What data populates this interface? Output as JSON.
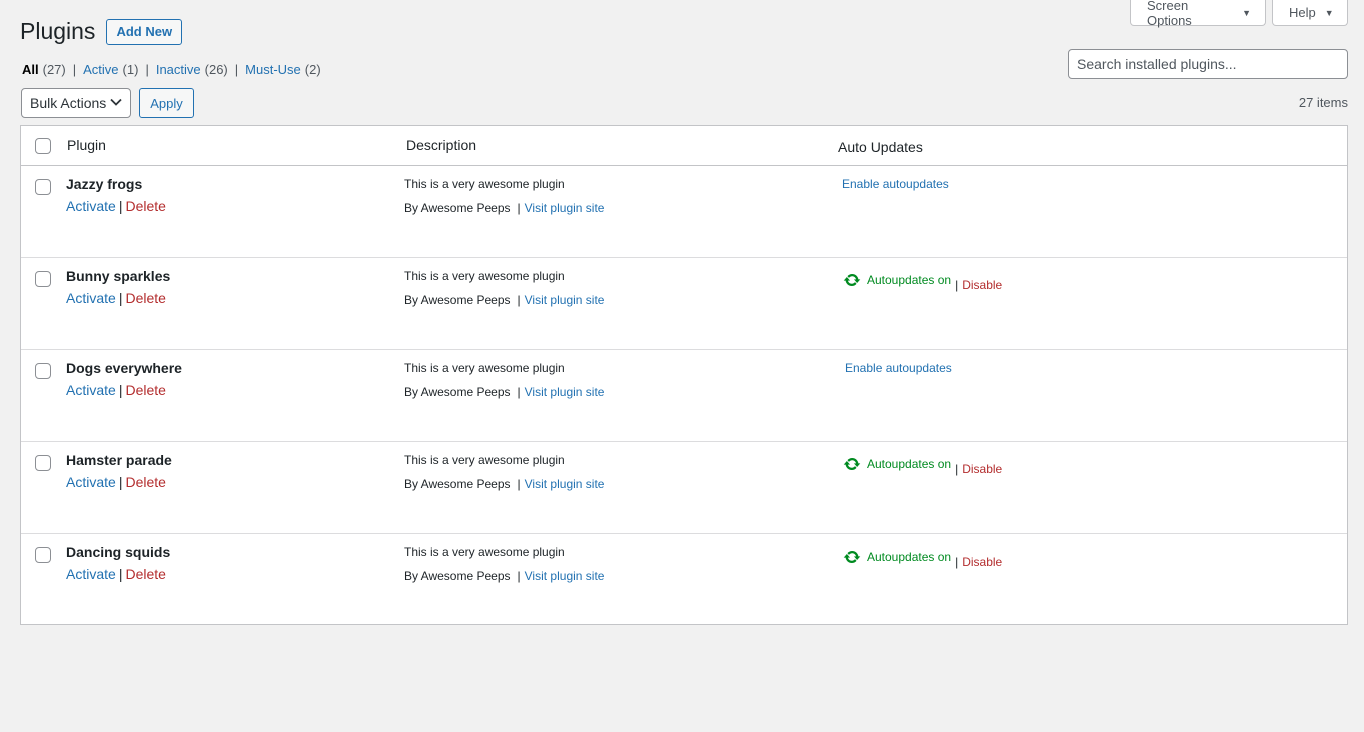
{
  "header": {
    "screen_options": "Screen Options",
    "help": "Help",
    "title": "Plugins",
    "add_new": "Add New"
  },
  "filters": {
    "all_label": "All",
    "all_count": "(27)",
    "active_label": "Active",
    "active_count": "(1)",
    "inactive_label": "Inactive",
    "inactive_count": "(26)",
    "mustuse_label": "Must-Use",
    "mustuse_count": "(2)",
    "separator": "|"
  },
  "search": {
    "placeholder": "Search installed plugins..."
  },
  "tablenav": {
    "bulk_actions": "Bulk Actions",
    "apply": "Apply",
    "items_count": "27 items"
  },
  "table": {
    "headers": {
      "plugin": "Plugin",
      "description": "Description",
      "auto_updates": "Auto Updates"
    },
    "rows": [
      {
        "name": "Jazzy frogs",
        "activate": "Activate",
        "delete": "Delete",
        "description": "This is a very awesome plugin",
        "by": "By Awesome Peeps",
        "visit": "Visit plugin site",
        "auto_enable": "Enable autoupdates"
      },
      {
        "name": "Bunny sparkles",
        "activate": "Activate",
        "delete": "Delete",
        "description": "This is a very awesome plugin",
        "by": "By Awesome Peeps",
        "visit": "Visit plugin site",
        "auto_on": "Autoupdates on",
        "auto_disable": "Disable"
      },
      {
        "name": "Dogs everywhere",
        "activate": "Activate",
        "delete": "Delete",
        "description": "This is a very awesome plugin",
        "by": "By Awesome Peeps",
        "visit": "Visit plugin site",
        "auto_enable": "Enable autoupdates"
      },
      {
        "name": "Hamster parade",
        "activate": "Activate",
        "delete": "Delete",
        "description": "This is a very awesome plugin",
        "by": "By Awesome Peeps",
        "visit": "Visit plugin site",
        "auto_on": "Autoupdates on",
        "auto_disable": "Disable"
      },
      {
        "name": "Dancing squids",
        "activate": "Activate",
        "delete": "Delete",
        "description": "This is a very awesome plugin",
        "by": "By Awesome Peeps",
        "visit": "Visit plugin site",
        "auto_on": "Autoupdates on",
        "auto_disable": "Disable"
      }
    ]
  },
  "colors": {
    "link": "#2271b1",
    "delete": "#b32d2e",
    "autoupdate_on": "#008a20",
    "background": "#f1f1f1"
  },
  "icons": {
    "autoupdate": "update-icon",
    "dropdown": "caret-down-icon"
  }
}
